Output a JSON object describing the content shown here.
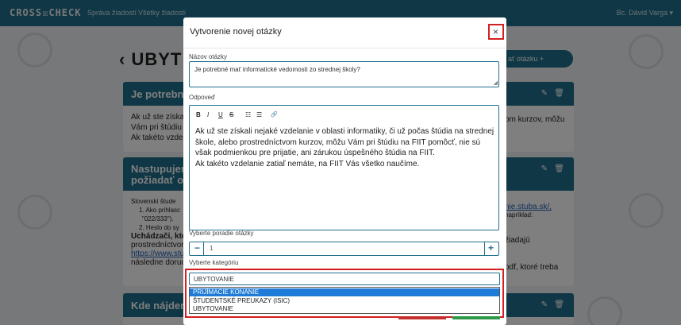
{
  "navbar": {
    "brand": "CROSS☒CHECK",
    "links": [
      "Správa žiadostí",
      "Všetky žiadosti"
    ],
    "user": "Bc. Dávid Varga ▾"
  },
  "page": {
    "title": "‹  UBYT",
    "add_button": "ať otázku  +"
  },
  "cards": [
    {
      "title": "Je potrebné",
      "body": "Ak už ste získa\nVám pri štúdiu\nAk takéto vzdel",
      "right": "om kurzov, môžu"
    },
    {
      "title": "Nastupujem\npožiadať o",
      "body_lines": [
        "Slovenskí štude",
        "1. Ako prihlasc",
        "\"022/333\").",
        "2. Heslo do sy",
        "Uchádzači, ktc",
        "prostredníctvon",
        "https://www.stu",
        "následne doruc"
      ],
      "right_lines": [
        "nie.stuba.sk/,",
        "napríklad:",
        "žiadajú",
        "pdf, ktoré treba"
      ]
    },
    {
      "title": "Kde nájdem"
    }
  ],
  "modal": {
    "title": "Vytvorenie novej otázky",
    "close": "×",
    "question_label": "Názov otázky",
    "question_value": "Je potrebné mať informatické vedomosti zo strednej školy?",
    "answer_label": "Odpoveď",
    "toolbar": [
      "B",
      "I",
      "U",
      "S",
      "☷",
      "☰",
      "🔗"
    ],
    "answer_text": "Ak už ste získali nejaké vzdelanie v oblasti informatiky, či už počas štúdia na strednej škole, alebo prostredníctvom kurzov, môžu Vám pri štúdiu na FIIT pomôcť, nie sú však podmienkou pre prijatie, ani zárukou úspešného štúdia na FIIT.\nAk takéto vzdelanie zatiaľ nemáte, na FIIT Vás všetko naučíme.",
    "order_label": "Vyberte poradie otázky",
    "order_value": "1",
    "category_label": "Vyberte kategóriu",
    "category_value": "UBYTOVANIE",
    "category_options": [
      "PRIJÍMACIE KONANIE",
      "ŠTUDENTSKÉ PREUKAZY (ISIC)",
      "UBYTOVANIE"
    ],
    "selected_option_index": 0
  },
  "colors": {
    "primary": "#1f6f8b",
    "highlight": "#d21f1f",
    "selected": "#1e7bd7"
  }
}
